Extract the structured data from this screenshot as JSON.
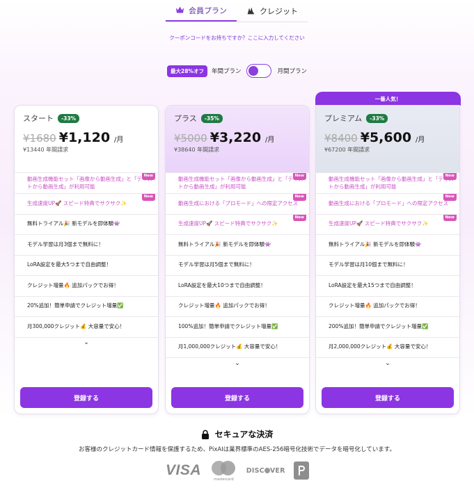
{
  "tabs": [
    {
      "label": "会員プラン",
      "icon": "crown-icon",
      "active": true
    },
    {
      "label": "クレジット",
      "icon": "crystal-icon",
      "active": false
    }
  ],
  "coupon_text": "クーポンコードをお持ちですか？ここに入力してください",
  "billing": {
    "discount_badge": "最大28%オフ",
    "annual_label": "年間プラン",
    "monthly_label": "月間プラン"
  },
  "popular_label": "一番人気！",
  "new_badge": "New",
  "more_chevron": "⌄",
  "plans": [
    {
      "name": "スタート",
      "discount": "-33%",
      "old_price": "¥1680",
      "new_price": "¥1,120",
      "per": "/月",
      "annual": "¥13440 年間請求",
      "button": "登録する",
      "features": [
        "動画生成機能セット「画像から動画生成」と「テキストから動画生成」が利用可能",
        "生成速度UP🚀 スピード特典でサクサク✨",
        "無料トライアル🎉 新モデルを即体験👾",
        "モデル学習は月3個まで無料に！",
        "LoRA設定を最大5つまで自由調整！",
        "クレジット増量🔥 追加パックでお得！",
        "20%追加！簡単申請でクレジット増量✅",
        "月300,000クレジット💰 大容量で安心！"
      ]
    },
    {
      "name": "プラス",
      "discount": "-35%",
      "old_price": "¥5000",
      "new_price": "¥3,220",
      "per": "/月",
      "annual": "¥38640 年間請求",
      "button": "登録する",
      "features": [
        "動画生成機能セット「画像から動画生成」と「テキストから動画生成」が利用可能",
        "動画生成における「プロモード」への限定アクセス",
        "生成速度UP🚀 スピード特典でサクサク✨",
        "無料トライアル🎉 新モデルを即体験👾",
        "モデル学習は月5個まで無料に！",
        "LoRA設定を最大10つまで自由調整！",
        "クレジット増量🔥 追加パックでお得！",
        "100%追加！簡単申請でクレジット増量✅",
        "月1,000,000クレジット💰 大容量で安心！"
      ]
    },
    {
      "name": "プレミアム",
      "discount": "-33%",
      "old_price": "¥8400",
      "new_price": "¥5,600",
      "per": "/月",
      "annual": "¥67200 年間請求",
      "button": "登録する",
      "features": [
        "動画生成機能セット「画像から動画生成」と「テキストから動画生成」が利用可能",
        "動画生成における「プロモード」への限定アクセス",
        "生成速度UP🚀 スピード特典でサクサク✨",
        "無料トライアル🎉 新モデルを即体験👾",
        "モデル学習は月10個まで無料に！",
        "LoRA設定を最大15つまで自由調整！",
        "クレジット増量🔥 追加パックでお得！",
        "200%追加！簡単申請でクレジット増量✅",
        "月2,000,000クレジット💰 大容量で安心！"
      ]
    }
  ],
  "secure": {
    "title": "セキュアな決済",
    "description": "お客様のクレジットカード情報を保護するため、PixAIは業界標準のAES-256暗号化技術でデータを暗号化しています。",
    "logos": {
      "visa": "VISA",
      "mastercard": "mastercard",
      "discover_a": "DISC",
      "discover_b": "VER"
    }
  },
  "colors": {
    "accent": "#8c35e3",
    "discount_green": "#1f7a44",
    "new_pink": "#d855b8"
  }
}
